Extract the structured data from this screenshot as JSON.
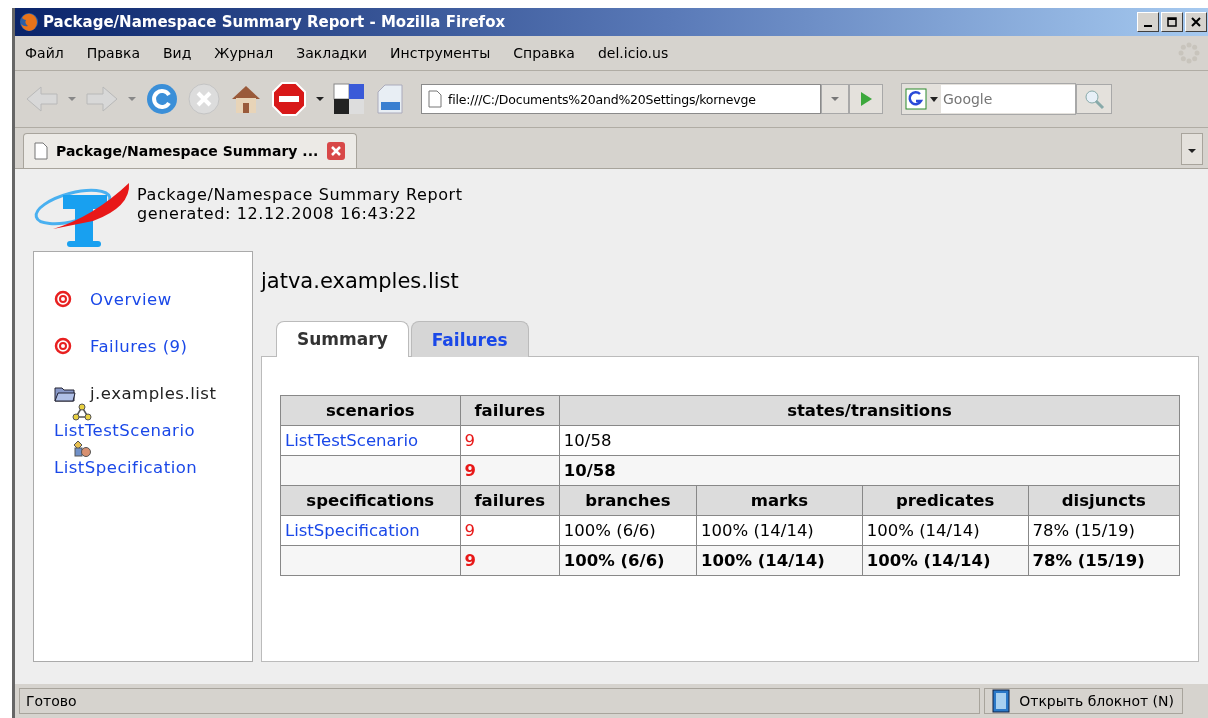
{
  "window": {
    "title": "Package/Namespace Summary Report - Mozilla Firefox"
  },
  "menu": [
    "Файл",
    "Правка",
    "Вид",
    "Журнал",
    "Закладки",
    "Инструменты",
    "Справка",
    "del.icio.us"
  ],
  "toolbar": {
    "url": "file:///C:/Documents%20and%20Settings/kornevge",
    "search_placeholder": "Google"
  },
  "browser_tabs": [
    {
      "label": "Package/Namespace Summary ...",
      "selected": true
    }
  ],
  "page": {
    "title": "Package/Namespace Summary Report",
    "generated": "generated: 12.12.2008 16:43:22",
    "sidebar": [
      {
        "kind": "link",
        "label": "Overview"
      },
      {
        "kind": "link",
        "label": "Failures (9)"
      },
      {
        "kind": "package",
        "label": "j.examples.list"
      },
      {
        "kind": "scenario",
        "label": "ListTestScenario"
      },
      {
        "kind": "specification",
        "label": "ListSpecification"
      }
    ],
    "heading": "jatva.examples.list",
    "tabs": [
      {
        "label": "Summary",
        "selected": true
      },
      {
        "label": "Failures",
        "selected": false
      }
    ],
    "scenario_table": {
      "columns": [
        "scenarios",
        "failures",
        "states/transitions"
      ],
      "rows": [
        {
          "name": "ListTestScenario",
          "failures": "9",
          "states": "10/58"
        }
      ],
      "total": {
        "failures": "9",
        "states": "10/58"
      }
    },
    "spec_table": {
      "columns": [
        "specifications",
        "failures",
        "branches",
        "marks",
        "predicates",
        "disjuncts"
      ],
      "rows": [
        {
          "name": "ListSpecification",
          "failures": "9",
          "values": [
            "100% (6/6)",
            "100% (14/14)",
            "100% (14/14)",
            "78% (15/19)"
          ]
        }
      ],
      "total": {
        "failures": "9",
        "values": [
          "100% (6/6)",
          "100% (14/14)",
          "100% (14/14)",
          "78% (15/19)"
        ]
      }
    }
  },
  "status_bar": {
    "text": "Готово",
    "notepad": "Открыть блокнот (N)"
  }
}
